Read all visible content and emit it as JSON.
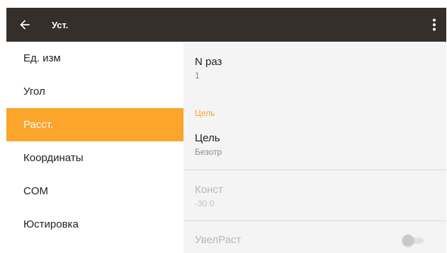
{
  "appbar": {
    "title": "Уст.",
    "back_icon": "arrow-back-icon",
    "overflow_icon": "more-vert-icon",
    "color": "#352f2c"
  },
  "menu": {
    "accent": "#fba52a",
    "selected": "Расст.",
    "items": [
      {
        "label": "Ед. изм"
      },
      {
        "label": "Угол"
      },
      {
        "label": "Расст."
      },
      {
        "label": "Координаты"
      },
      {
        "label": "COM"
      },
      {
        "label": "Юстировка"
      }
    ]
  },
  "settings": {
    "n_times": {
      "label": "N раз",
      "value": "1"
    },
    "section_target": "Цель",
    "target": {
      "label": "Цель",
      "value": "Безотр"
    },
    "const": {
      "label": "Конст",
      "value": "-30.0",
      "enabled": false
    },
    "incr_dist": {
      "label": "УвелРаст",
      "enabled": false,
      "toggle_on": false
    }
  }
}
